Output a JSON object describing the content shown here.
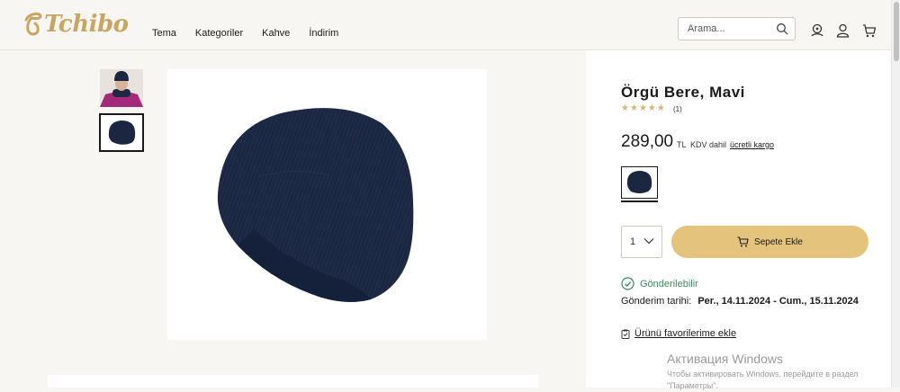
{
  "header": {
    "logo_text": "Tchibo",
    "nav": [
      "Tema",
      "Kategoriler",
      "Kahve",
      "İndirim"
    ],
    "search_placeholder": "Arama..."
  },
  "product": {
    "title": "Örgü Bere, Mavi",
    "rating_stars": 5,
    "rating_count": "(1)",
    "price": "289,00",
    "currency": "TL",
    "vat_note": "KDV dahil",
    "cargo_link": "ücretli kargo",
    "quantity": "1",
    "add_to_cart": "Sepete Ekle",
    "ship_status": "Gönderilebilir",
    "ship_date_label": "Gönderim tarihi:",
    "ship_date_value": "Per., 14.11.2024 - Cum., 15.11.2024",
    "favorite_link": "Ürünü favorilerime ekle"
  },
  "colors": {
    "brand_gold": "#c7a563",
    "cart_button": "#e4c47d",
    "ship_green": "#3e8a5c",
    "hat_navy": "#1b2740"
  },
  "overlay": {
    "title": "Активация Windows",
    "subtitle": "Чтобы активировать Windows, перейдите в раздел \"Параметры\"."
  }
}
